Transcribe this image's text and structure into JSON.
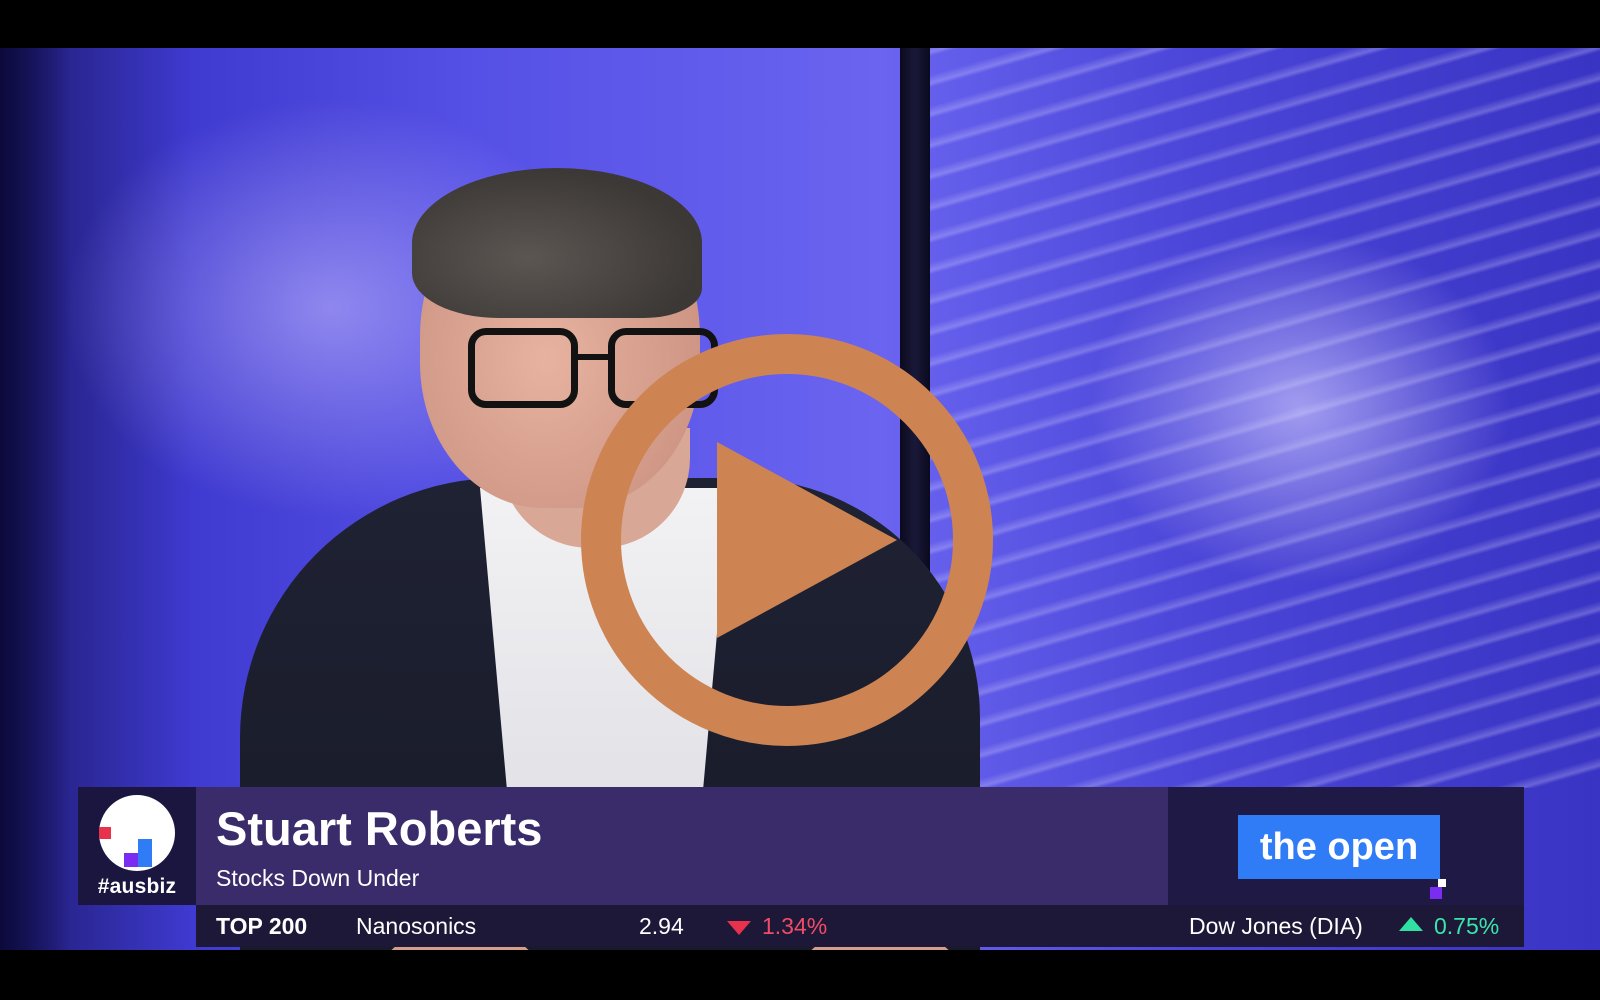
{
  "presenter": {
    "name": "Stuart Roberts",
    "subtitle": "Stocks Down Under"
  },
  "channel": {
    "hashtag": "#ausbiz"
  },
  "show": {
    "title": "the open"
  },
  "ticker": {
    "index_label": "TOP 200",
    "stock_name": "Nanosonics",
    "stock_price": "2.94",
    "stock_change": "1.34%",
    "stock_direction": "down",
    "us_index_label": "Dow Jones (DIA)",
    "us_index_change": "0.75%",
    "us_index_direction": "up"
  },
  "player": {
    "play_icon": "play-icon",
    "accent_color": "#cd8452"
  },
  "colors": {
    "down": "#f04c68",
    "up": "#39e6a8",
    "brand_blue": "#2f7cf6",
    "nameplate_purple": "#3a2c6a"
  }
}
